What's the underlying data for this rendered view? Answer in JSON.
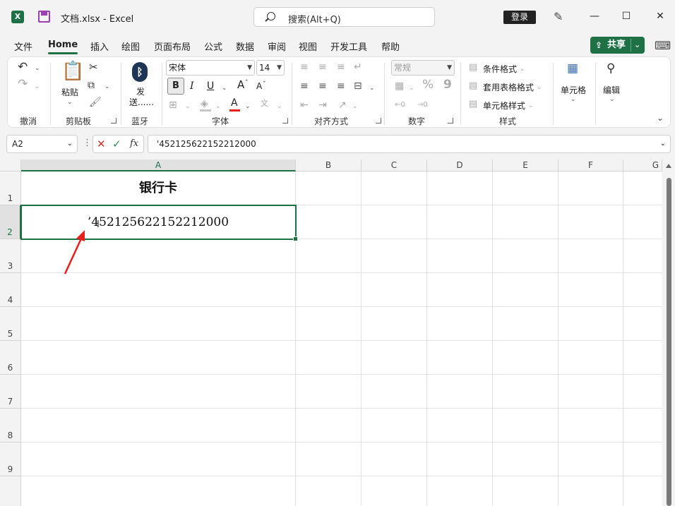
{
  "title_bar": {
    "logo": "X",
    "title": "文档.xlsx  -  Excel",
    "search_placeholder": "搜索(Alt+Q)",
    "login_label": "登录",
    "min_glyph": "—",
    "max_glyph": "☐",
    "close_glyph": "✕"
  },
  "tabs": [
    "文件",
    "Home",
    "插入",
    "绘图",
    "页面布局",
    "公式",
    "数据",
    "审阅",
    "视图",
    "开发工具",
    "帮助"
  ],
  "active_tab": "Home",
  "share_label": "共享",
  "ribbon": {
    "undo_group": "撤消",
    "clipboard": {
      "paste_label": "粘贴",
      "group": "剪贴板"
    },
    "bluetooth": {
      "label_1": "发",
      "label_2": "送......",
      "group": "蓝牙"
    },
    "font": {
      "name": "宋体",
      "size": "14",
      "bold": "B",
      "italic": "I",
      "underline": "U",
      "grow": "A",
      "shrink": "A",
      "color_a": "A",
      "group": "字体"
    },
    "alignment": {
      "group": "对齐方式"
    },
    "number": {
      "format": "常规",
      "percent": "%",
      "comma": "9",
      "group": "数字"
    },
    "styles": {
      "conditional": "条件格式",
      "table": "套用表格格式",
      "cell_styles": "单元格样式",
      "group": "样式"
    },
    "cells_label": "单元格",
    "edit_label": "编辑"
  },
  "formula_bar": {
    "name_box": "A2",
    "formula": "'452125622152212000"
  },
  "sheet": {
    "columns": [
      "A",
      "B",
      "C",
      "D",
      "E",
      "F",
      "G"
    ],
    "selected_column": "A",
    "rows": [
      "1",
      "2",
      "3",
      "4",
      "5",
      "6",
      "7",
      "8",
      "9"
    ],
    "selected_row": "2",
    "cells": {
      "A1": "银行卡",
      "A2": "’452125622152212000"
    }
  },
  "colors": {
    "accent": "#1e7145",
    "arrow": "#e8201c"
  }
}
